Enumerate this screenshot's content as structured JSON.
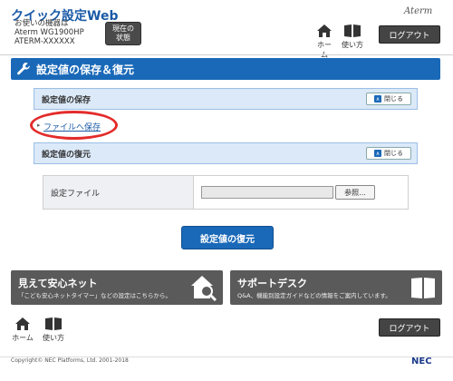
{
  "header": {
    "app_title": "クイック設定Web",
    "device_label": "お使いの機器は",
    "device_model": "Aterm WG1900HP",
    "device_id": "ATERM-XXXXXX",
    "status_button_line1": "現在の",
    "status_button_line2": "状態",
    "brand": "Aterm",
    "home_label": "ホーム",
    "manual_label": "使い方",
    "logout_label": "ログアウト"
  },
  "main": {
    "page_title": "設定値の保存＆復元",
    "save_section": {
      "title": "設定値の保存",
      "collapse_label": "閉じる",
      "link_label": "ファイルへ保存"
    },
    "restore_section": {
      "title": "設定値の復元",
      "collapse_label": "閉じる",
      "file_label": "設定ファイル",
      "browse_label": "参照...",
      "file_value": ""
    },
    "restore_button_label": "設定値の復元"
  },
  "banners": [
    {
      "title": "見えて安心ネット",
      "description": "「こども安心ネットタイマー」などの設定はこちらから。",
      "icon": "house-magnifier-icon"
    },
    {
      "title": "サポートデスク",
      "description": "Q&A、機能別設定ガイドなどの情報をご案内しています。",
      "icon": "book-icon"
    }
  ],
  "footer": {
    "home_label": "ホーム",
    "manual_label": "使い方",
    "logout_label": "ログアウト",
    "copyright": "Copyright© NEC Platforms, Ltd. 2001-2018",
    "company_logo": "NEC"
  },
  "colors": {
    "accent_blue": "#1a69b8",
    "section_bg": "#dbe9f8",
    "highlight_red": "#e32b2b",
    "banner_gray": "#5a5a5a"
  }
}
